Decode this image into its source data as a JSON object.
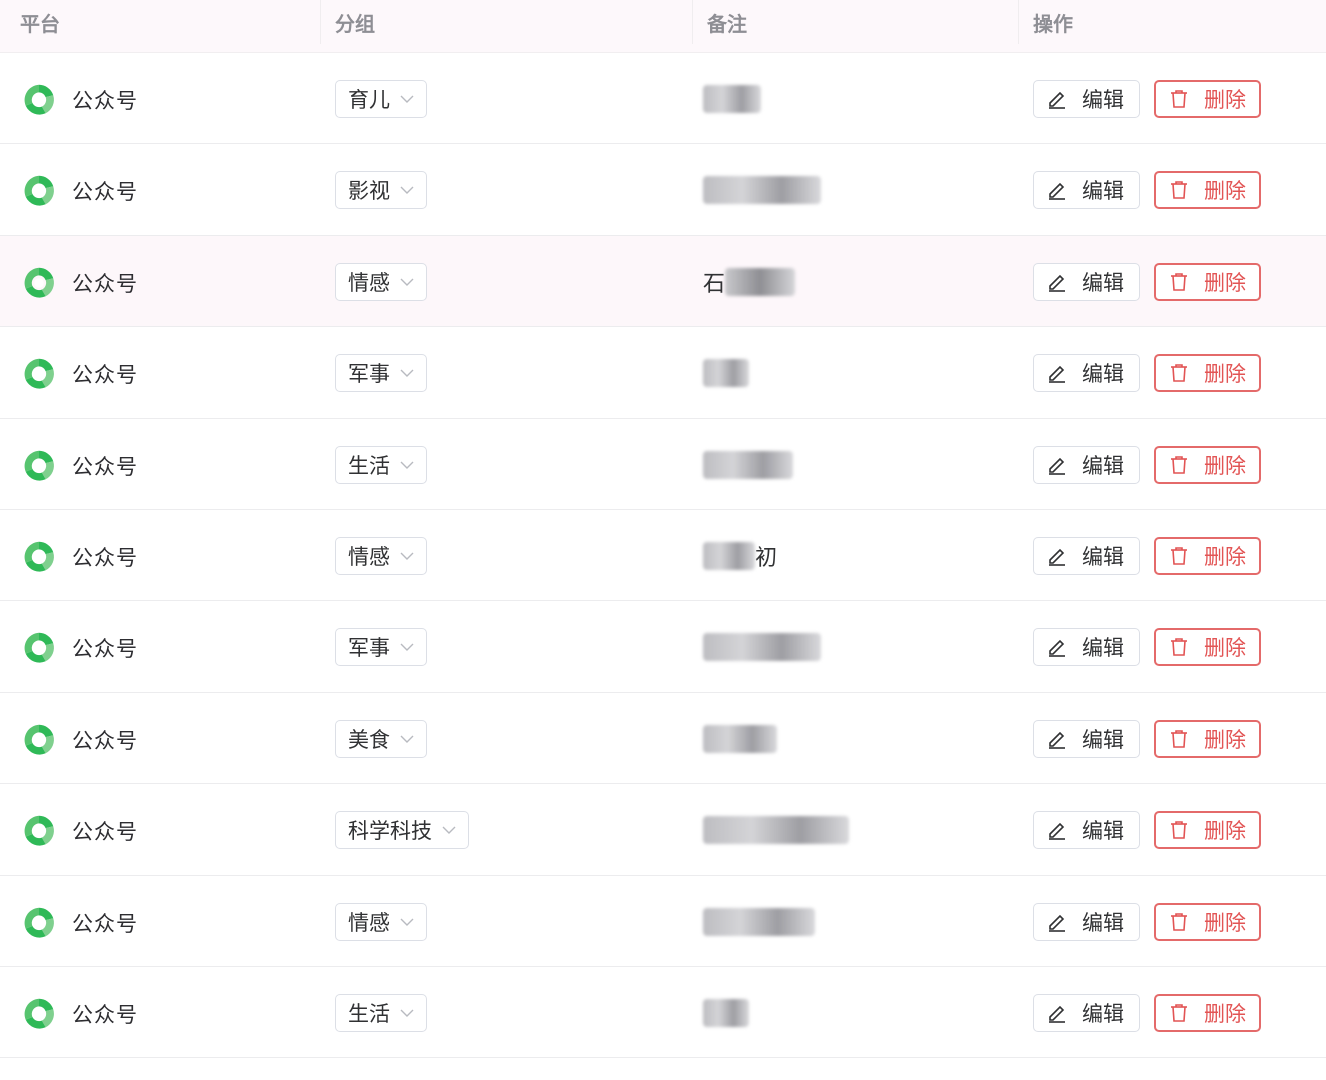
{
  "columns": {
    "platform": "平台",
    "group": "分组",
    "remark": "备注",
    "actions": "操作"
  },
  "actions": {
    "edit_label": "编辑",
    "delete_label": "删除"
  },
  "colors": {
    "accent_green": "#2fb957",
    "danger_red": "#e25454"
  },
  "rows": [
    {
      "platform": "公众号",
      "group": "育儿",
      "remark_visible": ""
    },
    {
      "platform": "公众号",
      "group": "影视",
      "remark_visible": ""
    },
    {
      "platform": "公众号",
      "group": "情感",
      "remark_visible": "石"
    },
    {
      "platform": "公众号",
      "group": "军事",
      "remark_visible": ""
    },
    {
      "platform": "公众号",
      "group": "生活",
      "remark_visible": ""
    },
    {
      "platform": "公众号",
      "group": "情感",
      "remark_visible": "初"
    },
    {
      "platform": "公众号",
      "group": "军事",
      "remark_visible": ""
    },
    {
      "platform": "公众号",
      "group": "美食",
      "remark_visible": ""
    },
    {
      "platform": "公众号",
      "group": "科学科技",
      "remark_visible": ""
    },
    {
      "platform": "公众号",
      "group": "情感",
      "remark_visible": ""
    },
    {
      "platform": "公众号",
      "group": "生活",
      "remark_visible": ""
    }
  ]
}
